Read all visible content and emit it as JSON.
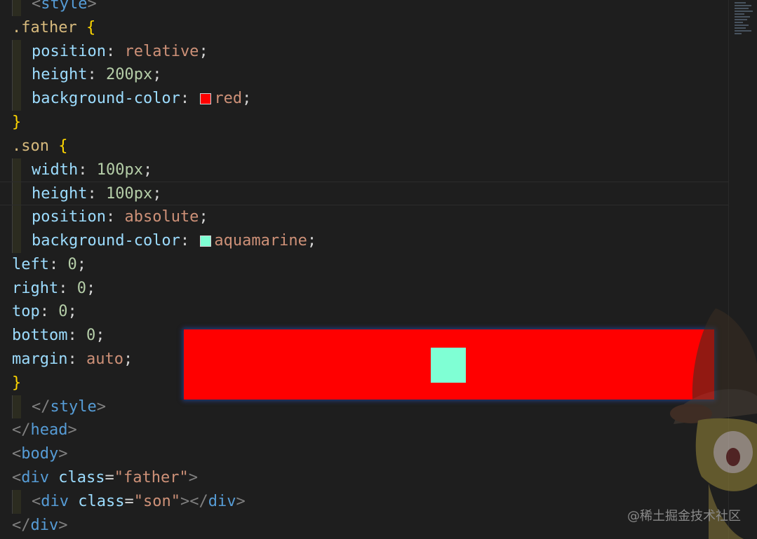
{
  "colors": {
    "background": "#1e1e1e",
    "selector": "#d7ba7d",
    "brace": "#ffd700",
    "property": "#9cdcfe",
    "value": "#ce9178",
    "number": "#b5cea8",
    "tag": "#569cd6",
    "bracket": "#808080",
    "swatch_red": "#ff0000",
    "swatch_aquamarine": "#7fffd4",
    "preview_father": "#ff0000",
    "preview_son": "#7fffd4"
  },
  "code": {
    "line1": {
      "open": "<",
      "tag": "style",
      "close": ">"
    },
    "line2": {
      "selector": ".father",
      "brace": "{"
    },
    "line3": {
      "prop": "position",
      "colon": ": ",
      "value": "relative",
      "semi": ";"
    },
    "line4": {
      "prop": "height",
      "colon": ": ",
      "value": "200px",
      "semi": ";"
    },
    "line5": {
      "prop": "background-color",
      "colon": ": ",
      "value": "red",
      "semi": ";",
      "swatch_icon": "color-swatch-red-icon"
    },
    "line6": {
      "brace": "}"
    },
    "line7": {
      "selector": ".son",
      "brace": "{"
    },
    "line8": {
      "prop": "width",
      "colon": ": ",
      "value": "100px",
      "semi": ";"
    },
    "line9": {
      "prop": "height",
      "colon": ": ",
      "value": "100px",
      "semi": ";"
    },
    "line10": {
      "prop": "position",
      "colon": ": ",
      "value": "absolute",
      "semi": ";"
    },
    "line11": {
      "prop": "background-color",
      "colon": ": ",
      "value": "aquamarine",
      "semi": ";",
      "swatch_icon": "color-swatch-aquamarine-icon"
    },
    "line12": {
      "prop": "left",
      "colon": ": ",
      "value": "0",
      "semi": ";"
    },
    "line13": {
      "prop": "right",
      "colon": ": ",
      "value": "0",
      "semi": ";"
    },
    "line14": {
      "prop": "top",
      "colon": ": ",
      "value": "0",
      "semi": ";"
    },
    "line15": {
      "prop": "bottom",
      "colon": ": ",
      "value": "0",
      "semi": ";"
    },
    "line16": {
      "prop": "margin",
      "colon": ": ",
      "value": "auto",
      "semi": ";"
    },
    "line17": {
      "brace": "}"
    },
    "line18": {
      "open": "</",
      "tag": "style",
      "close": ">"
    },
    "line19": {
      "open": "</",
      "tag": "head",
      "close": ">"
    },
    "line20": {
      "open": "<",
      "tag": "body",
      "close": ">"
    },
    "line21": {
      "open": "<",
      "tag": "div",
      "attr": "class",
      "eq": "=",
      "str": "\"father\"",
      "close": ">"
    },
    "line22": {
      "open": "<",
      "tag": "div",
      "attr": "class",
      "eq": "=",
      "str": "\"son\"",
      "close": "></",
      "tag2": "div",
      "close2": ">"
    },
    "line23": {
      "open": "</",
      "tag": "div",
      "close": ">"
    }
  },
  "watermark": "@稀土掘金技术社区",
  "mascot_icon": "anime-character-icon",
  "minimap_icon": "minimap-icon"
}
